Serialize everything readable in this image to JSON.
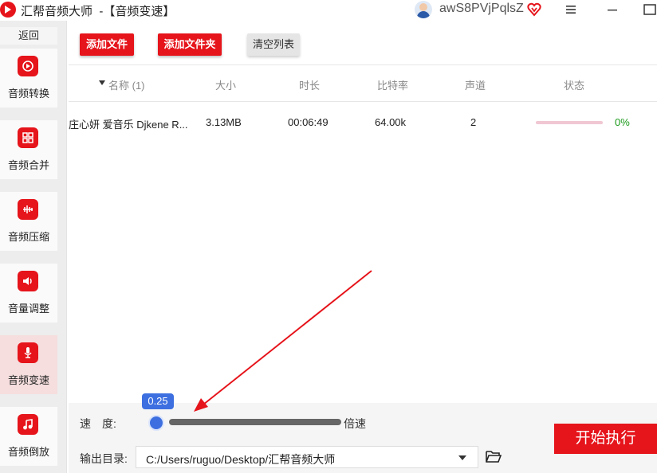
{
  "titlebar": {
    "title": "汇帮音频大师  -【音频变速】",
    "username": "awS8PVjPqlsZ",
    "icons": [
      "app-logo-icon",
      "user-avatar-icon",
      "vip-heart-icon",
      "menu-icon",
      "minimize-icon",
      "maximize-icon"
    ]
  },
  "sidebar": {
    "back_label": "返回",
    "items": [
      {
        "label": "音频转换",
        "icon": "audio-convert-icon"
      },
      {
        "label": "音频合并",
        "icon": "audio-merge-icon"
      },
      {
        "label": "音频压缩",
        "icon": "audio-compress-icon"
      },
      {
        "label": "音量调整",
        "icon": "volume-adjust-icon"
      },
      {
        "label": "音频变速",
        "icon": "audio-speed-icon",
        "active": true
      },
      {
        "label": "音频倒放",
        "icon": "audio-reverse-icon"
      }
    ]
  },
  "toolbar": {
    "add_file": "添加文件",
    "add_folder": "添加文件夹",
    "clear_list": "清空列表"
  },
  "table": {
    "headers": {
      "name": "名称 (1)",
      "size": "大小",
      "duration": "时长",
      "bitrate": "比特率",
      "channels": "声道",
      "status": "状态"
    },
    "rows": [
      {
        "name": "庄心妍 爱音乐 Djkene R...",
        "size": "3.13MB",
        "duration": "00:06:49",
        "bitrate": "64.00k",
        "channels": "2",
        "status": "0%",
        "progress": 0
      }
    ]
  },
  "speed": {
    "label": "速　度:",
    "value": "0.25",
    "unit": "倍速"
  },
  "output": {
    "label": "输出目录:",
    "path": "C:/Users/ruguo/Desktop/汇帮音频大师"
  },
  "start_button": "开始执行",
  "colors": {
    "accent": "#e6141b",
    "slider": "#3d6fe0",
    "progress_ok": "#1a9a1a"
  }
}
